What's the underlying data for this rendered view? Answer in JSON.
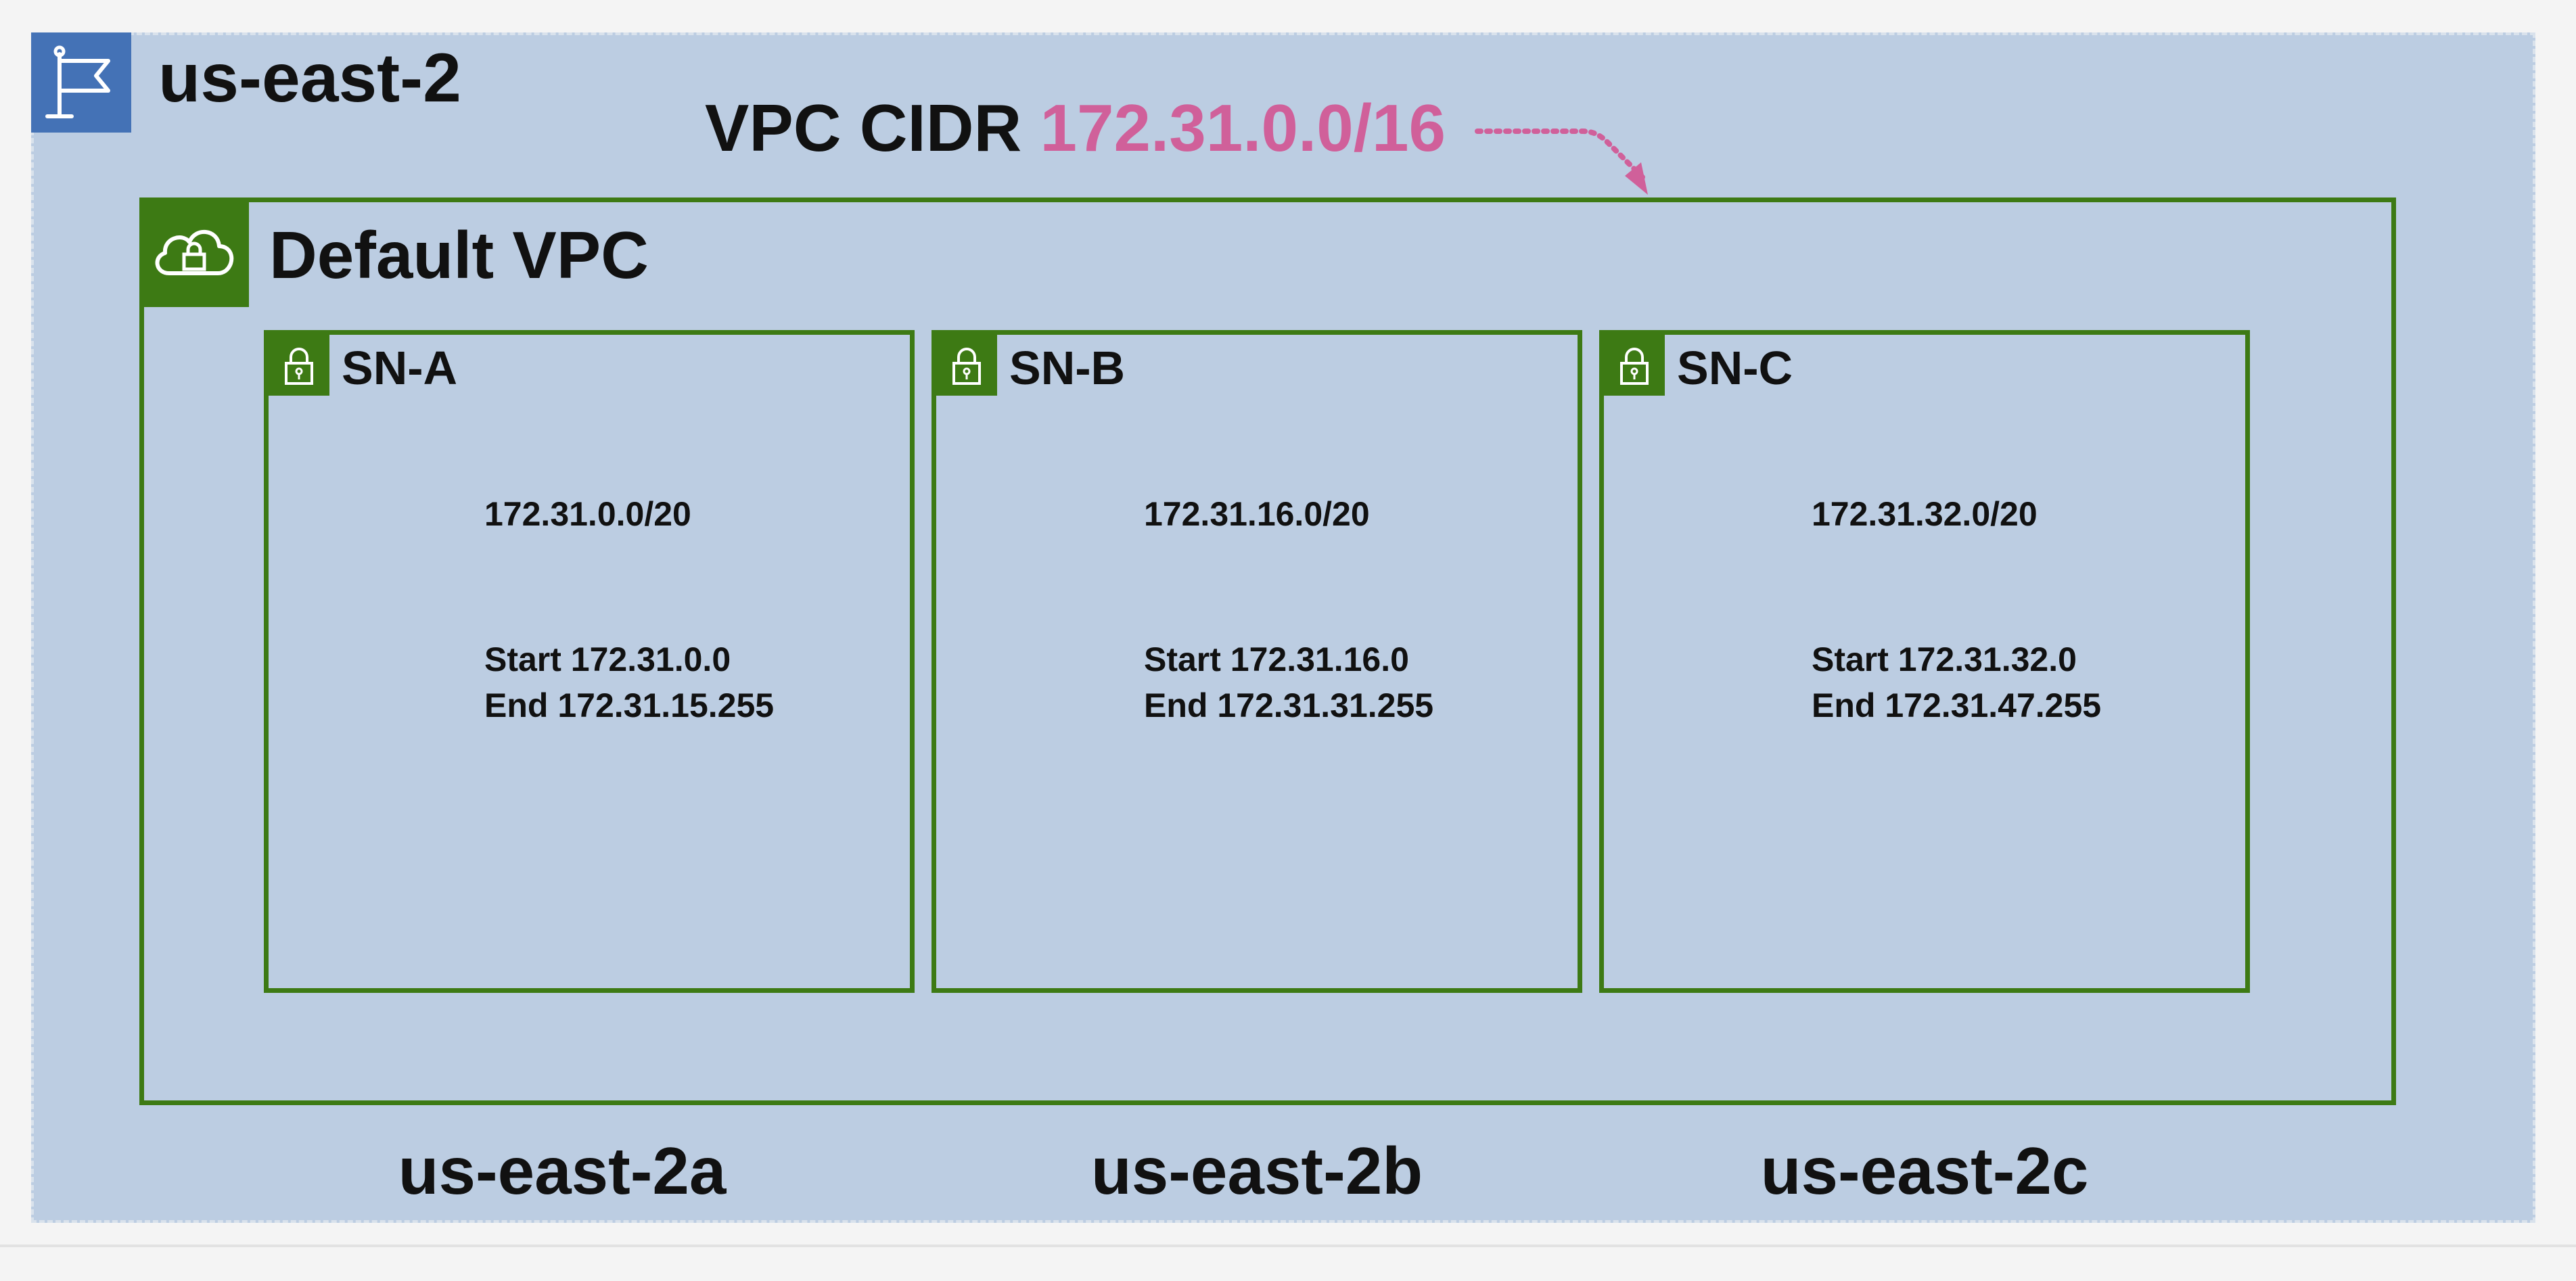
{
  "region": {
    "name": "us-east-2",
    "icon": "flag-icon",
    "color": "#4472b6",
    "background": "#bccde2"
  },
  "vpc_cidr": {
    "label": "VPC CIDR",
    "value": "172.31.0.0/16",
    "value_color": "#d0609a"
  },
  "vpc": {
    "name": "Default VPC",
    "icon": "cloud-lock-icon",
    "color": "#3d7a14"
  },
  "subnets": [
    {
      "name": "SN-A",
      "cidr": "172.31.0.0/20",
      "start": "Start 172.31.0.0",
      "end": "End 172.31.15.255",
      "az": "us-east-2a",
      "icon": "lock-icon"
    },
    {
      "name": "SN-B",
      "cidr": "172.31.16.0/20",
      "start": "Start 172.31.16.0",
      "end": "End 172.31.31.255",
      "az": "us-east-2b",
      "icon": "lock-icon"
    },
    {
      "name": "SN-C",
      "cidr": "172.31.32.0/20",
      "start": "Start 172.31.32.0",
      "end": "End 172.31.47.255",
      "az": "us-east-2c",
      "icon": "lock-icon"
    }
  ]
}
